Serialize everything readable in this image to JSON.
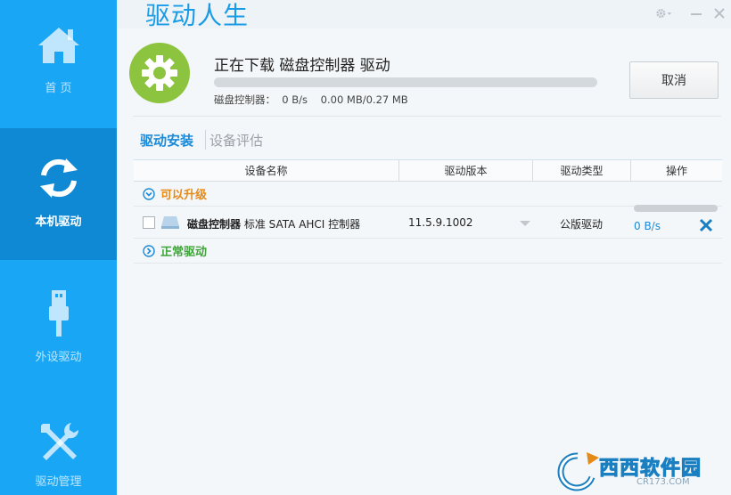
{
  "app": {
    "title": "驱动人生"
  },
  "sidebar": {
    "items": [
      {
        "label": "首 页",
        "icon": "home-icon",
        "active": false
      },
      {
        "label": "本机驱动",
        "icon": "refresh-icon",
        "active": true
      },
      {
        "label": "外设驱动",
        "icon": "usb-icon",
        "active": false
      },
      {
        "label": "驱动管理",
        "icon": "tools-icon",
        "active": false
      }
    ]
  },
  "download": {
    "title": "正在下载 磁盘控制器 驱动",
    "stats": "磁盘控制器：  0 B/s    0.00 MB/0.27 MB",
    "progress": 0,
    "cancel_label": "取消"
  },
  "tabs": [
    {
      "label": "驱动安装",
      "active": true
    },
    {
      "label": "设备评估",
      "active": false
    }
  ],
  "table": {
    "columns": [
      "设备名称",
      "驱动版本",
      "驱动类型",
      "操作"
    ],
    "groups": [
      {
        "label": "可以升级",
        "rows": [
          {
            "category": "磁盘控制器",
            "name": "标准 SATA AHCI 控制器",
            "version": "11.5.9.1002",
            "type": "公版驱动",
            "speed": "0 B/s",
            "progress": 0
          }
        ]
      },
      {
        "label": "正常驱动",
        "rows": []
      }
    ]
  },
  "watermark": {
    "text": "西西软件园",
    "sub": "CR173.COM"
  },
  "colors": {
    "sidebar": "#19a6f5",
    "sidebar_active": "#1089d4",
    "accent": "#1a8ad8",
    "upgrade": "#e58a17",
    "normal": "#3fa43a",
    "gear_badge": "#8cc43f"
  }
}
